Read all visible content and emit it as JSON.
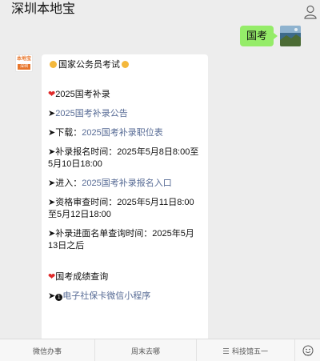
{
  "header": {
    "title": "深圳本地宝"
  },
  "outgoing": {
    "text": "国考"
  },
  "bot_avatar": {
    "logo_top": "本地宝",
    "logo_bottom": "深圳"
  },
  "message": {
    "heading": "国家公务员考试",
    "section1_title": "2025国考补录",
    "arrow": "➤",
    "link_notice": "2025国考补录公告",
    "download_prefix": "下载：",
    "link_positions": "2025国考补录职位表",
    "registration_time": "补录报名时间：2025年5月8日8:00至5月10日18:00",
    "enter_prefix": "进入：",
    "link_entry": "2025国考补录报名入口",
    "review_time": "资格审查时间：2025年5月11日8:00至5月12日18:00",
    "interview_list": "补录进面名单查询时间：2025年5月13日之后",
    "section2_title": "国考成绩查询",
    "num_marker": "1",
    "link_mini": "电子社保卡微信小程序"
  },
  "bottom_tabs": [
    "微信办事",
    "周末去哪",
    "科技馆五一"
  ]
}
